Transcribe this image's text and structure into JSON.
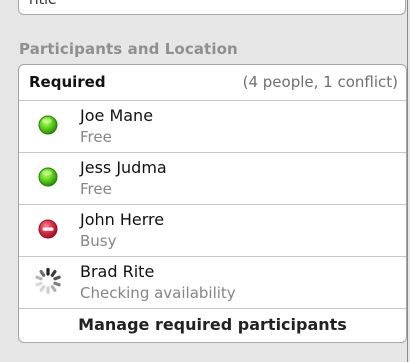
{
  "top_field": {
    "value": "ritle"
  },
  "section": {
    "heading": "Participants and Location"
  },
  "required": {
    "title": "Required",
    "summary": "(4 people, 1 conflict)",
    "participants": [
      {
        "name": "Joe Mane",
        "status": "Free",
        "icon": "green-circle-icon",
        "color": "#3fb20b"
      },
      {
        "name": "Jess Judma",
        "status": "Free",
        "icon": "green-circle-icon",
        "color": "#3fb20b"
      },
      {
        "name": "John Herre",
        "status": "Busy",
        "icon": "red-minus-icon",
        "color": "#d7223b"
      },
      {
        "name": "Brad Rite",
        "status": "Checking availability",
        "icon": "loading-spinner-icon",
        "color": "#9b9b9b"
      }
    ],
    "manage_label": "Manage required participants"
  },
  "colors": {
    "background": "#e6e6e6",
    "card_border": "#a6a6a6",
    "divider": "#c6c6c6",
    "heading": "#8f8f8f",
    "secondary_text": "#858585"
  }
}
